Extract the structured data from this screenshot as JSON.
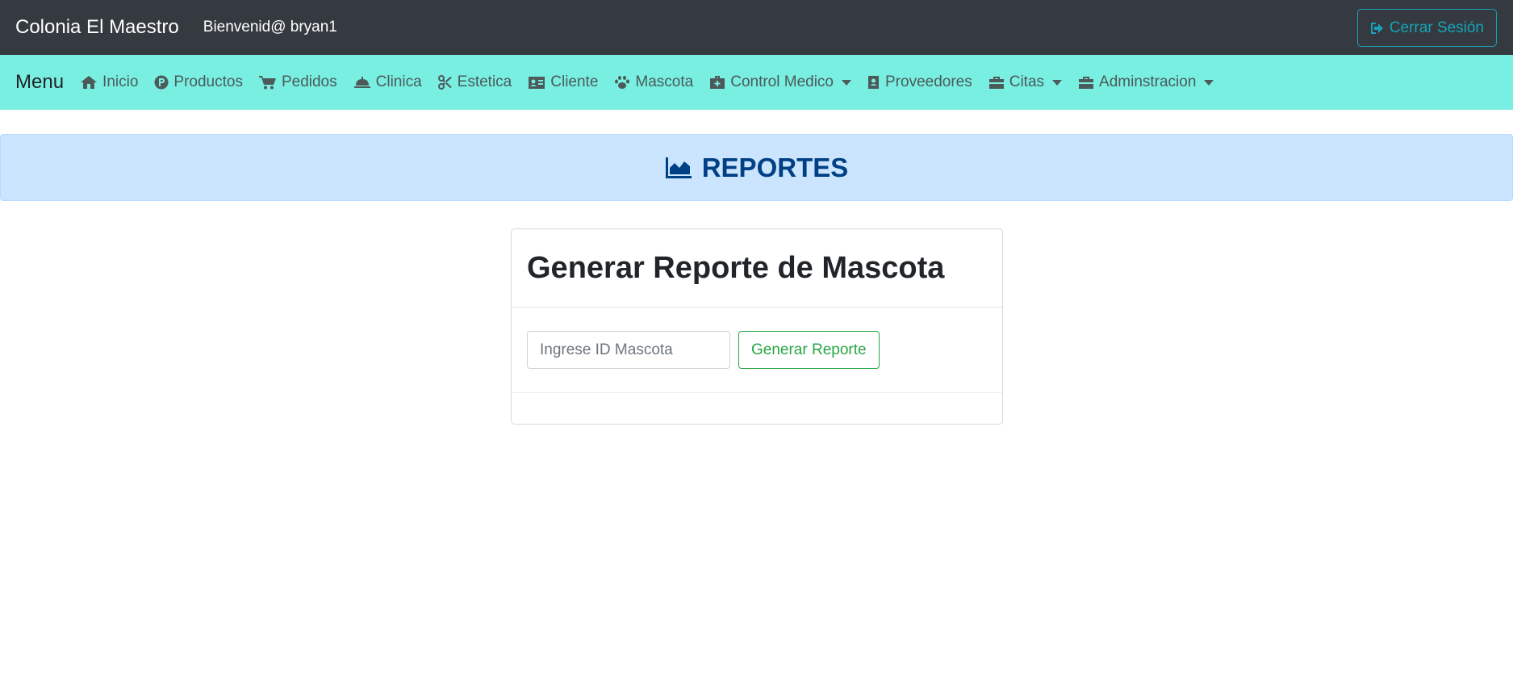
{
  "topbar": {
    "brand": "Colonia El Maestro",
    "welcome": "Bienvenid@ bryan1",
    "logout_label": "Cerrar Sesión"
  },
  "nav": {
    "menu_label": "Menu",
    "items": [
      {
        "label": "Inicio",
        "icon": "home-icon"
      },
      {
        "label": "Productos",
        "icon": "product-p-icon"
      },
      {
        "label": "Pedidos",
        "icon": "cart-icon"
      },
      {
        "label": "Clinica",
        "icon": "bell-icon"
      },
      {
        "label": "Estetica",
        "icon": "scissors-icon"
      },
      {
        "label": "Cliente",
        "icon": "id-card-icon"
      },
      {
        "label": "Mascota",
        "icon": "paw-icon"
      },
      {
        "label": "Control Medico",
        "icon": "medkit-icon",
        "dropdown": true
      },
      {
        "label": "Proveedores",
        "icon": "address-book-icon"
      },
      {
        "label": "Citas",
        "icon": "toolbox-icon",
        "dropdown": true
      },
      {
        "label": "Adminstracion",
        "icon": "toolbox-icon",
        "dropdown": true
      }
    ]
  },
  "banner": {
    "title": "REPORTES",
    "icon": "area-chart-icon"
  },
  "card": {
    "title": "Generar Reporte de Mascota",
    "input_placeholder": "Ingrese ID Mascota",
    "input_value": "",
    "button_label": "Generar Reporte"
  },
  "colors": {
    "topbar_bg": "#343a40",
    "navbar_bg": "#78efe1",
    "banner_bg": "#cce5ff",
    "banner_text": "#004085",
    "logout_accent": "#17a2b8",
    "button_accent": "#28a745"
  }
}
